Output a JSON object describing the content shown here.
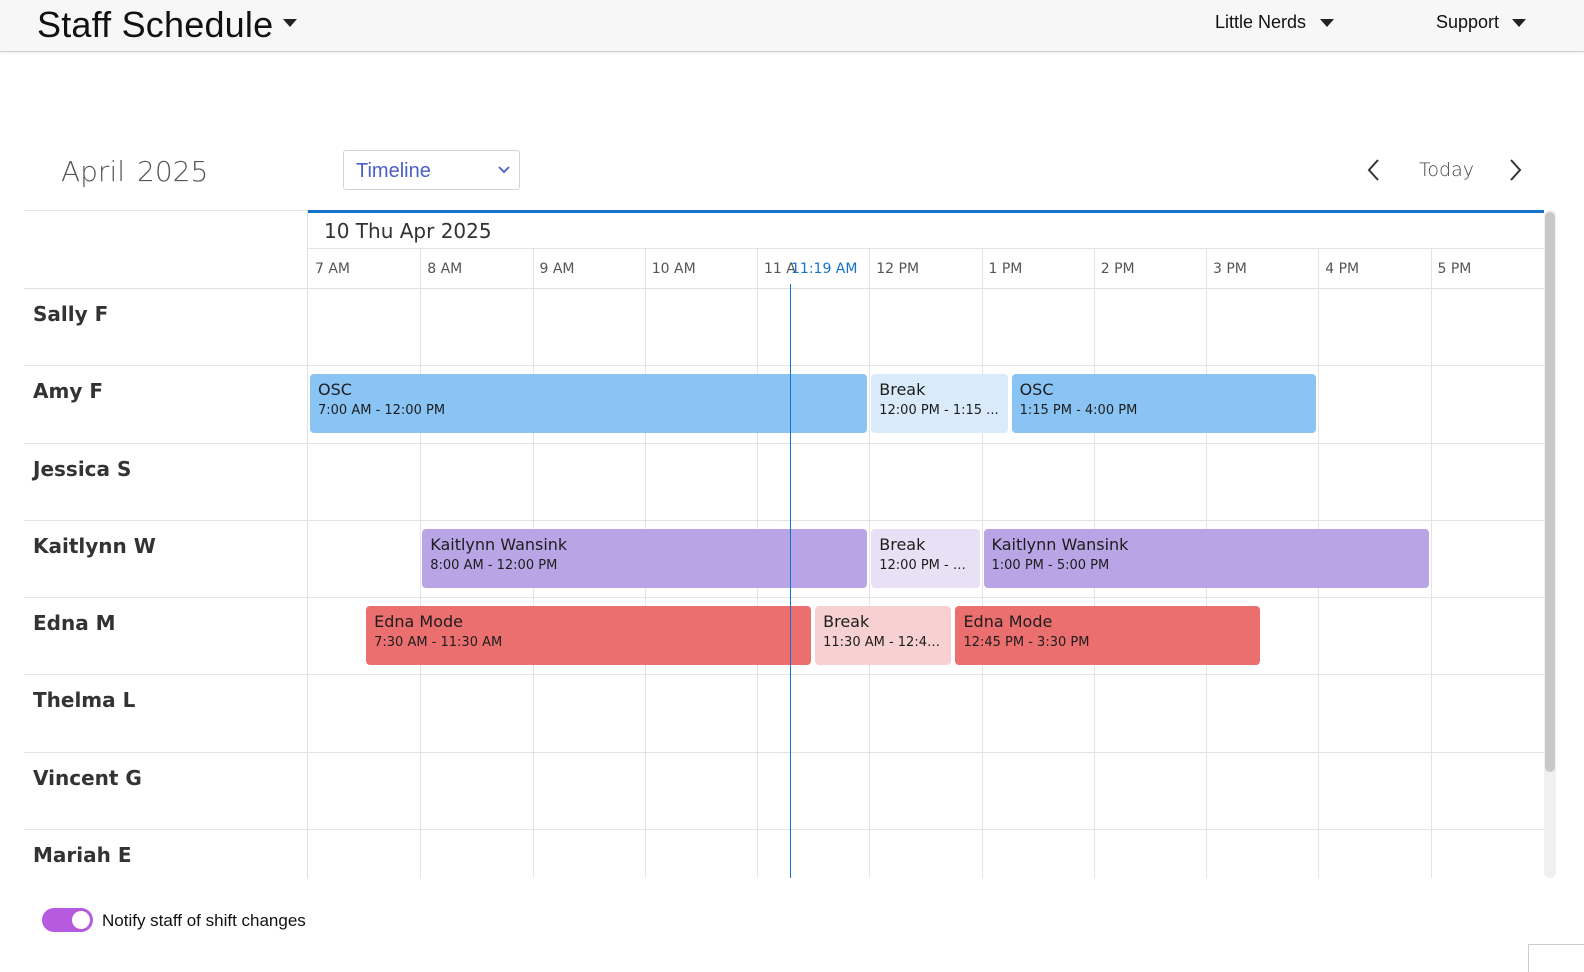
{
  "app": {
    "title": "Staff Schedule",
    "org_menu": "Little Nerds",
    "support_menu": "Support"
  },
  "scheduler": {
    "month": "April",
    "year": "2025",
    "view": "Timeline",
    "today_label": "Today",
    "date_label": "10 Thu Apr 2025",
    "time_labels": [
      "7 AM",
      "8 AM",
      "9 AM",
      "10 AM",
      "11 A",
      "12 PM",
      "1 PM",
      "2 PM",
      "3 PM",
      "4 PM",
      "5 PM"
    ],
    "current_time": "11:19 AM",
    "resources": [
      "Sally F",
      "Amy F",
      "Jessica S",
      "Kaitlynn W",
      "Edna M",
      "Thelma L",
      "Vincent G",
      "Mariah E"
    ],
    "events": [
      {
        "resource": "Amy F",
        "title": "OSC",
        "time": "7:00 AM - 12:00 PM",
        "color": "#8ac4f4"
      },
      {
        "resource": "Amy F",
        "title": "Break",
        "time": "12:00 PM - 1:15 ...",
        "color": "#d9ebfb"
      },
      {
        "resource": "Amy F",
        "title": "OSC",
        "time": "1:15 PM - 4:00 PM",
        "color": "#8ac4f4"
      },
      {
        "resource": "Kaitlynn W",
        "title": "Kaitlynn Wansink",
        "time": "8:00 AM - 12:00 PM",
        "color": "#b9a4e6"
      },
      {
        "resource": "Kaitlynn W",
        "title": "Break",
        "time": "12:00 PM - 1:...",
        "color": "#e8e0f4"
      },
      {
        "resource": "Kaitlynn W",
        "title": "Kaitlynn Wansink",
        "time": "1:00 PM - 5:00 PM",
        "color": "#b9a4e6"
      },
      {
        "resource": "Edna M",
        "title": "Edna Mode",
        "time": "7:30 AM - 11:30 AM",
        "color": "#ec6f70"
      },
      {
        "resource": "Edna M",
        "title": "Break",
        "time": "11:30 AM - 12:45...",
        "color": "#f7d1d1"
      },
      {
        "resource": "Edna M",
        "title": "Edna Mode",
        "time": "12:45 PM - 3:30 PM",
        "color": "#ec6f70"
      }
    ]
  },
  "footer": {
    "notify_label": "Notify staff of shift changes",
    "notify_on": true
  },
  "colors": {
    "accent": "#1673cc",
    "toggle": "#b65be0",
    "view_select_text": "#4b5fc9"
  },
  "icons": {
    "prev": "chevron-left-icon",
    "next": "chevron-right-icon",
    "view_select": "chevron-down-icon"
  }
}
